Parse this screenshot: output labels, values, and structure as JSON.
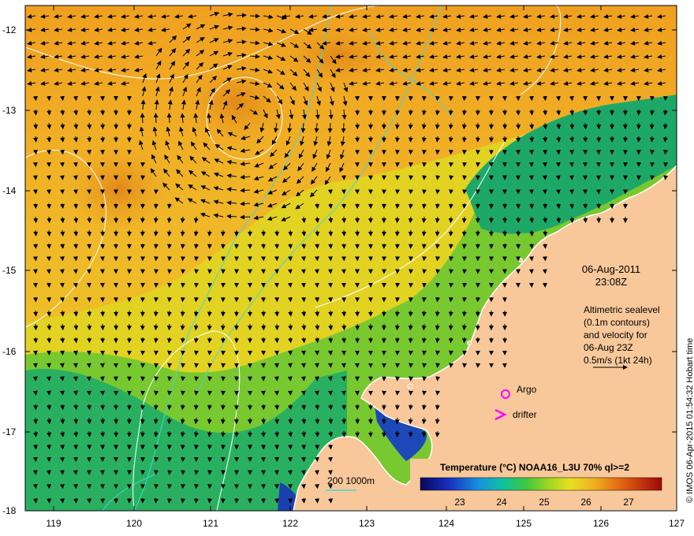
{
  "map": {
    "lat_ticks": [
      "-12",
      "-13",
      "-14",
      "-15",
      "-16",
      "-17",
      "-18"
    ],
    "lon_ticks": [
      "119",
      "120",
      "121",
      "122",
      "123",
      "124",
      "125",
      "126",
      "127"
    ],
    "colors": {
      "land": "#f8c89a",
      "ocean_warm": "#f0a020",
      "ocean_mid": "#e6d020",
      "ocean_cool": "#70c830",
      "ocean_cold": "#18a868",
      "ocean_coldest": "#1840b8",
      "bathymetry": "#40d8d8",
      "sealevel_contour": "#ffffff",
      "markers": "#ff00ff"
    }
  },
  "annotation": {
    "date": "06-Aug-2011",
    "time": "23:08Z",
    "desc_lines": [
      "Altimetric sealevel",
      "(0.1m contours)",
      "and velocity for",
      "06-Aug 23Z",
      "0.5m/s (1kt 24h)"
    ]
  },
  "legend": {
    "argo_label": "Argo",
    "drifter_label": "drifter",
    "bathymetry_label": "200  1000m"
  },
  "colorbar": {
    "title": "Temperature (°C) NOAA16_L3U 70% ql>=2",
    "ticks": [
      "23",
      "24",
      "25",
      "26",
      "27"
    ]
  },
  "credit": "© IMOS 06-Apr-2015 01:54:32 Hobart time"
}
